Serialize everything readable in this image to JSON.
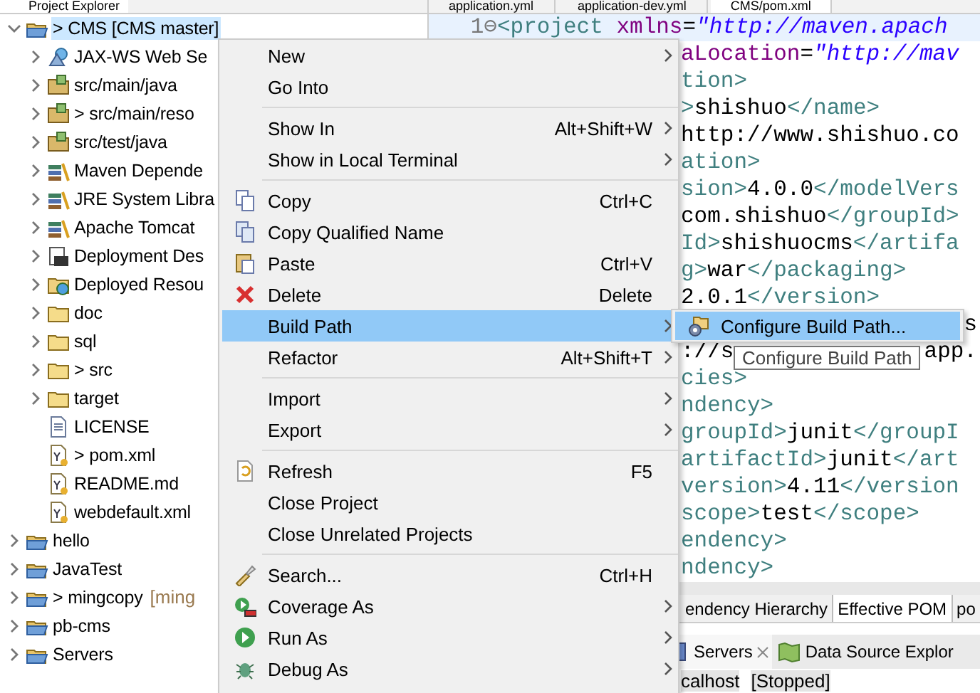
{
  "explorer": {
    "title": "Project Explorer",
    "tree": [
      {
        "label": "> CMS [CMS master]",
        "kind": "project",
        "expanded": true,
        "selected": true,
        "children": [
          {
            "label": "JAX-WS Web Se",
            "kind": "webservice",
            "expanded": false,
            "selected": false
          },
          {
            "label": "src/main/java",
            "kind": "package",
            "expanded": false,
            "selected": false
          },
          {
            "label": "> src/main/reso",
            "kind": "package",
            "expanded": false,
            "selected": false
          },
          {
            "label": "src/test/java",
            "kind": "package",
            "expanded": false,
            "selected": false
          },
          {
            "label": "Maven Depende",
            "kind": "library",
            "expanded": false,
            "selected": false
          },
          {
            "label": "JRE System Libra",
            "kind": "library",
            "expanded": false,
            "selected": false
          },
          {
            "label": "Apache Tomcat",
            "kind": "library",
            "expanded": false,
            "selected": false
          },
          {
            "label": "Deployment Des",
            "kind": "deployment",
            "expanded": false,
            "selected": false
          },
          {
            "label": "Deployed Resou",
            "kind": "resources",
            "expanded": false,
            "selected": false
          },
          {
            "label": "doc",
            "kind": "folder",
            "expanded": false,
            "selected": false
          },
          {
            "label": "sql",
            "kind": "folder",
            "expanded": false,
            "selected": false
          },
          {
            "label": "> src",
            "kind": "folder",
            "expanded": false,
            "selected": false
          },
          {
            "label": "target",
            "kind": "folder",
            "expanded": false,
            "selected": false
          },
          {
            "label": "LICENSE",
            "kind": "file",
            "selected": false
          },
          {
            "label": "> pom.xml",
            "kind": "xml",
            "selected": false
          },
          {
            "label": "README.md",
            "kind": "xml",
            "selected": false
          },
          {
            "label": "webdefault.xml",
            "kind": "xml",
            "selected": false
          }
        ]
      },
      {
        "label": "hello",
        "kind": "project",
        "expanded": false,
        "selected": false
      },
      {
        "label": "JavaTest",
        "kind": "project",
        "expanded": false,
        "selected": false
      },
      {
        "label": "> mingcopy",
        "branch": "[ming",
        "kind": "project",
        "expanded": false,
        "selected": false
      },
      {
        "label": "pb-cms",
        "kind": "project",
        "expanded": false,
        "selected": false
      },
      {
        "label": "Servers",
        "kind": "project",
        "expanded": false,
        "selected": false
      }
    ]
  },
  "editor": {
    "tabs": [
      {
        "label": "application.yml",
        "selected": false
      },
      {
        "label": "application-dev.yml",
        "selected": false
      },
      {
        "label": "CMS/pom.xml",
        "selected": true
      }
    ],
    "lines": [
      {
        "number": "1⊖",
        "kind": "code",
        "segments": [
          {
            "kind": "tag",
            "t": "<project"
          },
          {
            "kind": "attr",
            "t": " xmlns"
          },
          {
            "kind": "text",
            "t": "="
          },
          {
            "kind": "value",
            "t": "\"http://maven.apach"
          }
        ]
      },
      {
        "kind": "code",
        "segments": [
          {
            "kind": "attr",
            "t": "aLocation"
          },
          {
            "kind": "text",
            "t": "="
          },
          {
            "kind": "value",
            "t": "\"http://mav"
          }
        ]
      },
      {
        "kind": "code",
        "segments": [
          {
            "kind": "tag",
            "t": "tion>"
          }
        ]
      },
      {
        "kind": "code",
        "segments": [
          {
            "kind": "tag",
            "t": ">"
          },
          {
            "kind": "text",
            "t": "shishuo"
          },
          {
            "kind": "tag",
            "t": "</name>"
          }
        ]
      },
      {
        "kind": "code",
        "segments": [
          {
            "kind": "text",
            "t": "http://www.shishuo.co"
          }
        ]
      },
      {
        "kind": "code",
        "segments": [
          {
            "kind": "tag",
            "t": "ation>"
          }
        ]
      },
      {
        "kind": "code",
        "segments": [
          {
            "kind": "tag",
            "t": "sion>"
          },
          {
            "kind": "text",
            "t": "4.0.0"
          },
          {
            "kind": "tag",
            "t": "</modelVers"
          }
        ]
      },
      {
        "kind": "code",
        "segments": [
          {
            "kind": "text",
            "t": "com.shishuo"
          },
          {
            "kind": "tag",
            "t": "</groupId>"
          }
        ]
      },
      {
        "kind": "code",
        "segments": [
          {
            "kind": "tag",
            "t": "Id>"
          },
          {
            "kind": "text",
            "t": "shishuocms"
          },
          {
            "kind": "tag",
            "t": "</artifa"
          }
        ]
      },
      {
        "kind": "code",
        "segments": [
          {
            "kind": "tag",
            "t": "g>"
          },
          {
            "kind": "text",
            "t": "war"
          },
          {
            "kind": "tag",
            "t": "</packaging>"
          }
        ]
      },
      {
        "kind": "code",
        "segments": [
          {
            "kind": "text",
            "t": "2.0.1"
          },
          {
            "kind": "tag",
            "t": "</version>"
          }
        ]
      },
      {
        "kind": "tail",
        "segments": [
          {
            "kind": "text",
            "t": "s"
          }
        ]
      },
      {
        "kind": "split",
        "segments": [
          {
            "kind": "text",
            "t": "://s"
          },
          {
            "kind": "text",
            "t": "app."
          }
        ]
      },
      {
        "kind": "code",
        "segments": [
          {
            "kind": "tag",
            "t": "cies>"
          }
        ]
      },
      {
        "kind": "code",
        "segments": [
          {
            "kind": "tag",
            "t": "ndency>"
          }
        ]
      },
      {
        "kind": "code",
        "segments": [
          {
            "kind": "tag",
            "t": "groupId>"
          },
          {
            "kind": "text",
            "t": "junit"
          },
          {
            "kind": "tag",
            "t": "</groupI"
          }
        ]
      },
      {
        "kind": "code",
        "segments": [
          {
            "kind": "tag",
            "t": "artifactId>"
          },
          {
            "kind": "text",
            "t": "junit"
          },
          {
            "kind": "tag",
            "t": "</art"
          }
        ]
      },
      {
        "kind": "code",
        "segments": [
          {
            "kind": "tag",
            "t": "version>"
          },
          {
            "kind": "text",
            "t": "4.11"
          },
          {
            "kind": "tag",
            "t": "</version"
          }
        ]
      },
      {
        "kind": "code",
        "segments": [
          {
            "kind": "tag",
            "t": "scope>"
          },
          {
            "kind": "text",
            "t": "test"
          },
          {
            "kind": "tag",
            "t": "</scope>"
          }
        ]
      },
      {
        "kind": "code",
        "segments": [
          {
            "kind": "tag",
            "t": "endency>"
          }
        ]
      },
      {
        "kind": "code",
        "segments": [
          {
            "kind": "tag",
            "t": "ndency>"
          }
        ]
      }
    ],
    "bottom_tabs": [
      {
        "label": "endency Hierarchy",
        "selected": false
      },
      {
        "label": "Effective POM",
        "selected": true
      },
      {
        "label": "po",
        "selected": false
      }
    ]
  },
  "servers": {
    "tabs": [
      {
        "label": "Servers",
        "selected": true,
        "closable": true
      },
      {
        "label": "Data Source Explor",
        "selected": false,
        "closable": false
      }
    ],
    "row": {
      "label": "calhost",
      "status": "[Stopped]"
    }
  },
  "context_menu": {
    "items": [
      {
        "kind": "item",
        "label": "New",
        "submenu": true,
        "selected": false
      },
      {
        "kind": "item",
        "label": "Go Into",
        "submenu": false,
        "selected": false
      },
      {
        "kind": "separator"
      },
      {
        "kind": "item",
        "label": "Show In",
        "shortcut": "Alt+Shift+W",
        "submenu": true,
        "selected": false
      },
      {
        "kind": "item",
        "label": "Show in Local Terminal",
        "submenu": true,
        "selected": false
      },
      {
        "kind": "separator"
      },
      {
        "kind": "item",
        "label": "Copy",
        "shortcut": "Ctrl+C",
        "submenu": false,
        "selected": false
      },
      {
        "kind": "item",
        "label": "Copy Qualified Name",
        "submenu": false,
        "selected": false
      },
      {
        "kind": "item",
        "label": "Paste",
        "shortcut": "Ctrl+V",
        "submenu": false,
        "selected": false
      },
      {
        "kind": "item",
        "label": "Delete",
        "shortcut": "Delete",
        "submenu": false,
        "selected": false
      },
      {
        "kind": "item",
        "label": "Build Path",
        "submenu": true,
        "selected": true
      },
      {
        "kind": "item",
        "label": "Refactor",
        "shortcut": "Alt+Shift+T",
        "submenu": true,
        "selected": false
      },
      {
        "kind": "separator"
      },
      {
        "kind": "item",
        "label": "Import",
        "submenu": true,
        "selected": false
      },
      {
        "kind": "item",
        "label": "Export",
        "submenu": true,
        "selected": false
      },
      {
        "kind": "separator"
      },
      {
        "kind": "item",
        "label": "Refresh",
        "shortcut": "F5",
        "submenu": false,
        "selected": false
      },
      {
        "kind": "item",
        "label": "Close Project",
        "submenu": false,
        "selected": false
      },
      {
        "kind": "item",
        "label": "Close Unrelated Projects",
        "submenu": false,
        "selected": false
      },
      {
        "kind": "separator"
      },
      {
        "kind": "item",
        "label": "Search...",
        "shortcut": "Ctrl+H",
        "submenu": false,
        "selected": false
      },
      {
        "kind": "item",
        "label": "Coverage As",
        "submenu": true,
        "selected": false
      },
      {
        "kind": "item",
        "label": "Run As",
        "submenu": true,
        "selected": false
      },
      {
        "kind": "item",
        "label": "Debug As",
        "submenu": true,
        "selected": false
      }
    ]
  },
  "submenu": {
    "items": [
      {
        "label": "Configure Build Path...",
        "selected": true
      }
    ]
  },
  "tooltip": "Configure Build Path"
}
